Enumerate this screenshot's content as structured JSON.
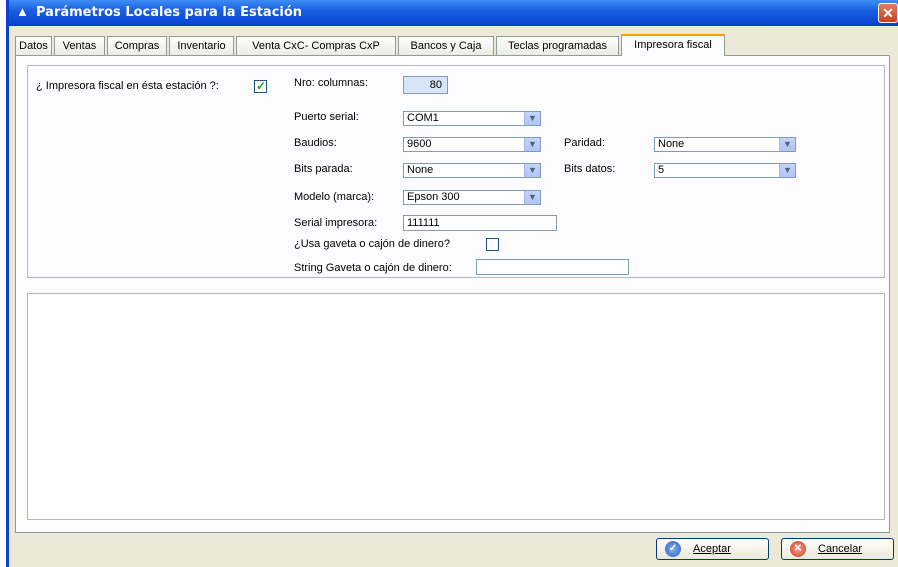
{
  "window": {
    "title": "Parámetros Locales para la Estación",
    "close_glyph": "✕"
  },
  "tabs": [
    {
      "label": "Datos"
    },
    {
      "label": "Ventas"
    },
    {
      "label": "Compras"
    },
    {
      "label": "Inventario"
    },
    {
      "label": "Venta CxC- Compras CxP"
    },
    {
      "label": "Bancos y Caja"
    },
    {
      "label": "Teclas programadas"
    },
    {
      "label": "Impresora fiscal"
    }
  ],
  "form": {
    "impresora_fiscal_label": "¿ Impresora fiscal en ésta estación ?:",
    "impresora_fiscal_checked": true,
    "nro_columnas_label": "Nro: columnas:",
    "nro_columnas_value": "80",
    "puerto_serial_label": "Puerto serial:",
    "puerto_serial_value": "COM1",
    "baudios_label": "Baudios:",
    "baudios_value": "9600",
    "paridad_label": "Paridad:",
    "paridad_value": "None",
    "bits_parada_label": "Bits parada:",
    "bits_parada_value": "None",
    "bits_datos_label": "Bits datos:",
    "bits_datos_value": "5",
    "modelo_label": "Modelo (marca):",
    "modelo_value": "Epson 300",
    "serial_label": "Serial impresora:",
    "serial_value": "111111",
    "gaveta_label": "¿Usa gaveta o cajón de dinero?",
    "gaveta_checked": false,
    "string_gaveta_label": "String Gaveta o cajón de dinero:",
    "string_gaveta_value": ""
  },
  "buttons": {
    "aceptar": "Aceptar",
    "cancelar": "Cancelar"
  },
  "colors": {
    "title_bar": "#0a46d4",
    "tab_highlight": "#f2a500",
    "check": "#21a121"
  }
}
